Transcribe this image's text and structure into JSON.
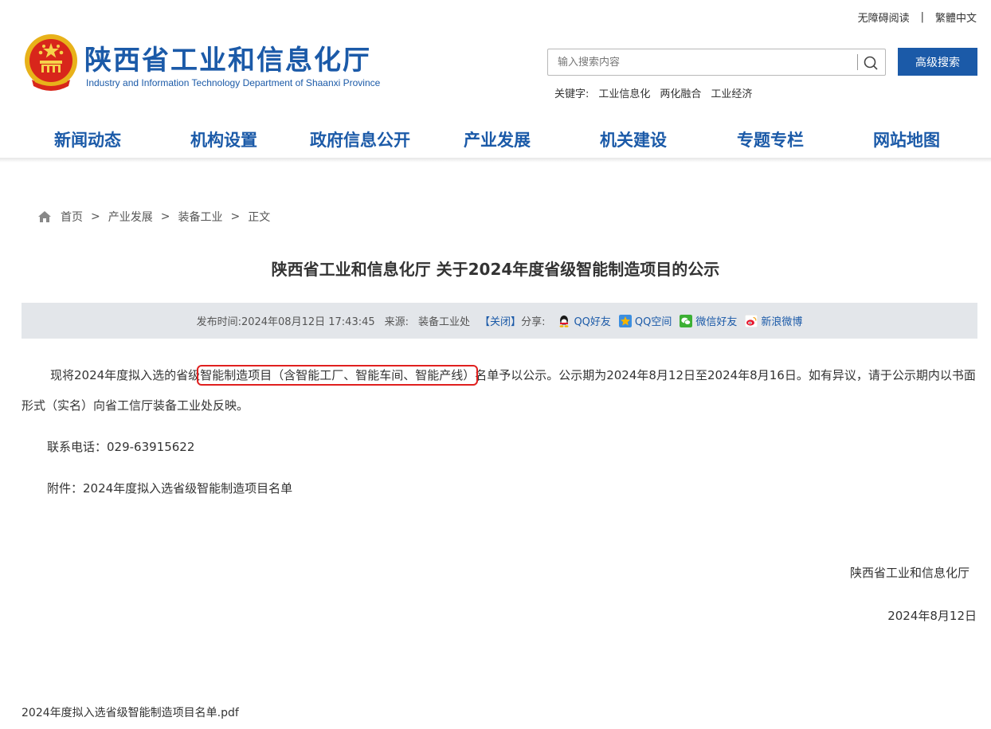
{
  "top_links": {
    "accessible": "无障碍阅读",
    "separator": "|",
    "traditional": "繁體中文"
  },
  "header": {
    "title": "陕西省工业和信息化厅",
    "subtitle": "Industry and Information Technology Department of Shaanxi Province",
    "emblem_icon": "national-emblem-icon"
  },
  "search": {
    "placeholder": "输入搜索内容",
    "value": "",
    "advanced_label": "高级搜索",
    "keywords_label": "关键字:",
    "keywords": [
      "工业信息化",
      "两化融合",
      "工业经济"
    ]
  },
  "nav": [
    "新闻动态",
    "机构设置",
    "政府信息公开",
    "产业发展",
    "机关建设",
    "专题专栏",
    "网站地图"
  ],
  "breadcrumb": [
    "首页",
    "产业发展",
    "装备工业",
    "正文"
  ],
  "breadcrumb_separator": ">",
  "article": {
    "title": "陕西省工业和信息化厅 关于2024年度省级智能制造项目的公示",
    "meta": {
      "published_label": "发布时间:",
      "published": "2024年08月12日 17:43:45",
      "source_label": "来源:",
      "source": "装备工业处",
      "close": "【关闭】",
      "share_label": "分享:",
      "share": [
        {
          "label": "QQ好友",
          "icon": "qq-icon",
          "color": "#1a1a1a"
        },
        {
          "label": "QQ空间",
          "icon": "qzone-icon",
          "color": "#f5b400"
        },
        {
          "label": "微信好友",
          "icon": "wechat-icon",
          "color": "#3cb034"
        },
        {
          "label": "新浪微博",
          "icon": "weibo-icon",
          "color": "#e6162d"
        }
      ]
    },
    "para1_before": "现将2024年度拟入选的省级",
    "para1_highlight": "智能制造项目（含智能工厂、智能车间、智能产线）",
    "para1_after": "名单予以公示。公示期为2024年8月12日至2024年8月16日。如有异议，请于公示期内以书面形式（实名）向省工信厅装备工业处反映。",
    "contact": "联系电话：029-63915622",
    "attachment_line": "附件：2024年度拟入选省级智能制造项目名单",
    "sign_org": "陕西省工业和信息化厅",
    "sign_date": "2024年8月12日",
    "attachment_file": "2024年度拟入选省级智能制造项目名单.pdf"
  },
  "colors": {
    "brand": "#1b5aa8",
    "highlight_border": "#e0201f",
    "meta_bg": "#e3e6ea"
  }
}
